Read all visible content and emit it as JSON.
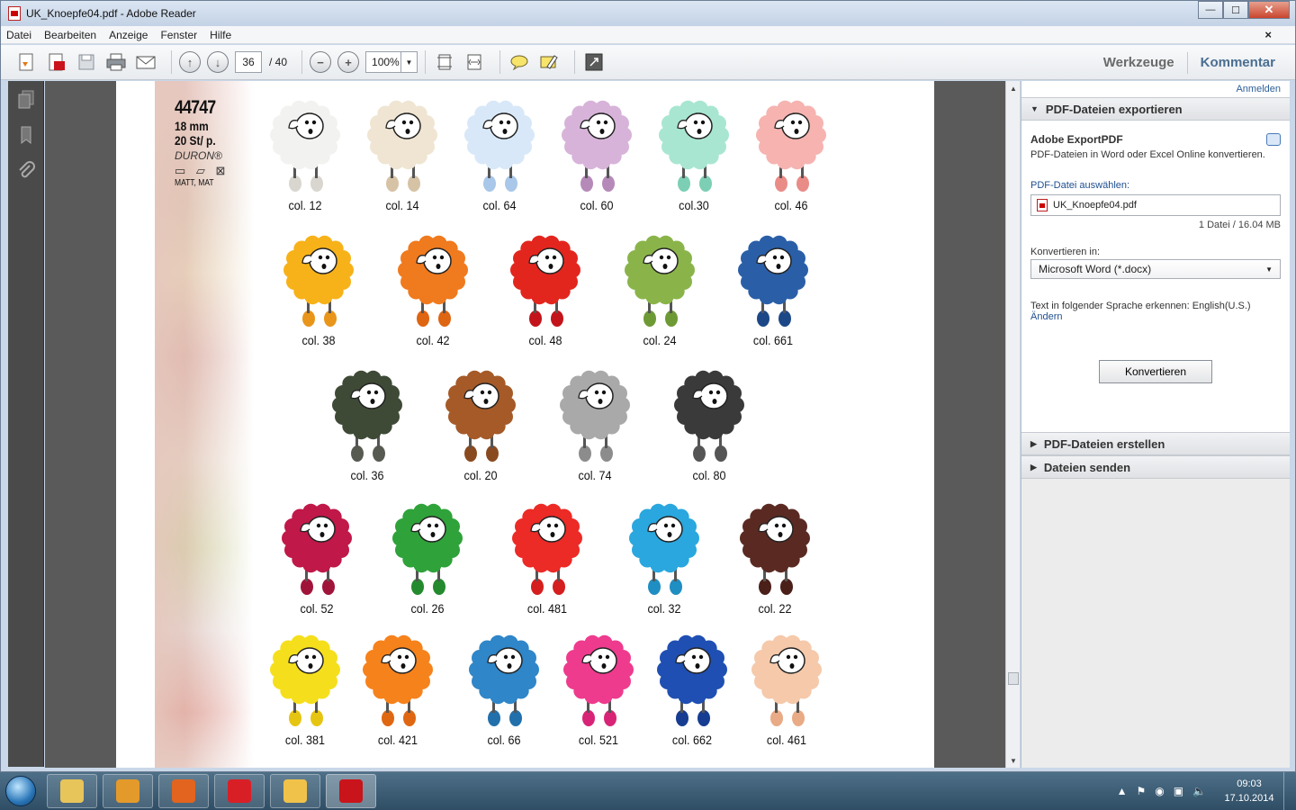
{
  "window": {
    "title": "UK_Knoepfe04.pdf - Adobe Reader",
    "controls": {
      "minimize": "—",
      "maximize": "☐",
      "close": "✕"
    }
  },
  "menu": [
    "Datei",
    "Bearbeiten",
    "Anzeige",
    "Fenster",
    "Hilfe"
  ],
  "menu_close_doc": "×",
  "toolbar": {
    "page_current": "36",
    "page_total": "/ 40",
    "zoom": "100%",
    "tools_label": "Werkzeuge",
    "comment_label": "Kommentar"
  },
  "product": {
    "code": "44747",
    "size": "18  mm",
    "pack": "20 St/ p.",
    "brand": "DURON®",
    "care": "▭ ▱ ⊠",
    "finish": "MATT, MAT"
  },
  "sheep": [
    {
      "label": "col. 12",
      "color": "#f2f2f0",
      "feet": "#d9d6cf"
    },
    {
      "label": "col. 14",
      "color": "#efe5d2",
      "feet": "#d6c3a6"
    },
    {
      "label": "col. 64",
      "color": "#d8e8f8",
      "feet": "#a9c7e8"
    },
    {
      "label": "col. 60",
      "color": "#d7b3d9",
      "feet": "#b58ab8"
    },
    {
      "label": "col.30",
      "color": "#a8e6d2",
      "feet": "#7ccfb4"
    },
    {
      "label": "col. 46",
      "color": "#f6b3b0",
      "feet": "#e98c88"
    },
    {
      "label": "col. 38",
      "color": "#f7b21a",
      "feet": "#e8951a"
    },
    {
      "label": "col. 42",
      "color": "#f07a1e",
      "feet": "#de6512"
    },
    {
      "label": "col. 48",
      "color": "#e2261e",
      "feet": "#c2141a"
    },
    {
      "label": "col. 24",
      "color": "#8ab44a",
      "feet": "#6e9a35"
    },
    {
      "label": "col. 661",
      "color": "#2a5fa8",
      "feet": "#1c4887"
    },
    {
      "label": "col. 36",
      "color": "#3e4a36",
      "feet": "#565a50"
    },
    {
      "label": "col. 20",
      "color": "#a55a28",
      "feet": "#8a4a20"
    },
    {
      "label": "col. 74",
      "color": "#a9a9a9",
      "feet": "#8c8c8c"
    },
    {
      "label": "col. 80",
      "color": "#3a3a3a",
      "feet": "#555555"
    },
    {
      "label": "col. 52",
      "color": "#c01848",
      "feet": "#a1143a"
    },
    {
      "label": "col. 26",
      "color": "#2fa23a",
      "feet": "#248a2e"
    },
    {
      "label": "col. 481",
      "color": "#ec2a26",
      "feet": "#d41f1e"
    },
    {
      "label": "col. 32",
      "color": "#2aa7de",
      "feet": "#1f8ec2"
    },
    {
      "label": "col. 22",
      "color": "#5a2a22",
      "feet": "#4a2019"
    },
    {
      "label": "col. 381",
      "color": "#f5df1c",
      "feet": "#e6c512"
    },
    {
      "label": "col. 421",
      "color": "#f6821c",
      "feet": "#e06712"
    },
    {
      "label": "col. 66",
      "color": "#2f86c8",
      "feet": "#2270ab"
    },
    {
      "label": "col. 521",
      "color": "#ee3b8e",
      "feet": "#d82477"
    },
    {
      "label": "col. 662",
      "color": "#1f4fb2",
      "feet": "#163d91"
    },
    {
      "label": "col. 461",
      "color": "#f5c9aa",
      "feet": "#e9aa86"
    }
  ],
  "panel": {
    "signin": "Anmelden",
    "export_header": "PDF-Dateien exportieren",
    "service_name": "Adobe ExportPDF",
    "service_desc": "PDF-Dateien in Word oder Excel Online konvertieren.",
    "choose_label": "PDF-Datei auswählen:",
    "file_name": "UK_Knoepfe04.pdf",
    "file_count": "1 Datei / 16.04 MB",
    "convert_to_label": "Konvertieren in:",
    "convert_format": "Microsoft Word (*.docx)",
    "language_text": "Text in folgender Sprache erkennen: English(U.S.)",
    "change_link": "Ändern",
    "convert_button": "Konvertieren",
    "create_header": "PDF-Dateien erstellen",
    "send_header": "Dateien senden"
  },
  "taskbar": {
    "apps": [
      {
        "name": "explorer",
        "color": "#e8c55a"
      },
      {
        "name": "media-player",
        "color": "#e49a2a"
      },
      {
        "name": "firefox",
        "color": "#e2641e"
      },
      {
        "name": "foxit",
        "color": "#d91f26"
      },
      {
        "name": "outlook-notes",
        "color": "#f0c24a"
      },
      {
        "name": "adobe-reader",
        "color": "#c8141a"
      }
    ],
    "time": "09:03",
    "date": "17.10.2014"
  }
}
